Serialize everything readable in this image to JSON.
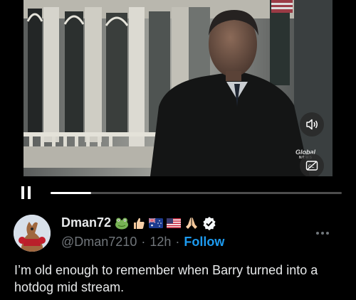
{
  "video": {
    "watermark": "Global",
    "watermark_sub": "NEWS",
    "progress_fraction": 0.14,
    "controls": [
      "volume-icon",
      "captions-icon",
      "pause-icon"
    ]
  },
  "post": {
    "display_name": "Dman72",
    "name_emojis": [
      "frog-icon",
      "thumbs-up-icon",
      "australia-flag-icon",
      "usa-flag-icon",
      "praying-hands-icon"
    ],
    "verified_icon": "verified-badge-icon",
    "handle": "@Dman7210",
    "separator": "·",
    "time": "12h",
    "follow_label": "Follow",
    "text": "I’m old enough to remember when Barry turned into a hotdog mid stream."
  },
  "colors": {
    "background": "#000000",
    "text_primary": "#e7e9ea",
    "text_secondary": "#71767b",
    "accent": "#1d9bf0"
  }
}
